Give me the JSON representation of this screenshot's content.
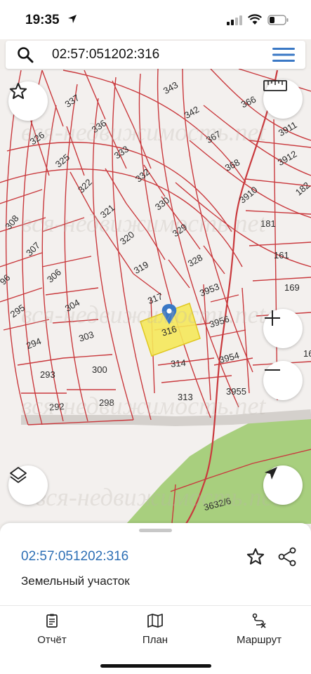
{
  "status": {
    "time": "19:35"
  },
  "search": {
    "query": "02:57:051202:316"
  },
  "map": {
    "selected_parcel": "316",
    "parcels": [
      {
        "id": "337",
        "label": "337"
      },
      {
        "id": "336",
        "label": "336"
      },
      {
        "id": "333",
        "label": "333"
      },
      {
        "id": "326",
        "label": "326"
      },
      {
        "id": "325",
        "label": "325"
      },
      {
        "id": "322",
        "label": "322"
      },
      {
        "id": "332",
        "label": "332"
      },
      {
        "id": "321",
        "label": "321"
      },
      {
        "id": "330",
        "label": "330"
      },
      {
        "id": "320",
        "label": "320"
      },
      {
        "id": "329",
        "label": "329"
      },
      {
        "id": "319",
        "label": "319"
      },
      {
        "id": "328",
        "label": "328"
      },
      {
        "id": "317",
        "label": "317"
      },
      {
        "id": "3953",
        "label": "3953"
      },
      {
        "id": "316",
        "label": "316"
      },
      {
        "id": "3956",
        "label": "3956"
      },
      {
        "id": "314",
        "label": "314"
      },
      {
        "id": "3954",
        "label": "3954"
      },
      {
        "id": "313",
        "label": "313"
      },
      {
        "id": "3955",
        "label": "3955"
      },
      {
        "id": "343",
        "label": "343"
      },
      {
        "id": "342",
        "label": "342"
      },
      {
        "id": "367",
        "label": "367"
      },
      {
        "id": "366",
        "label": "366"
      },
      {
        "id": "3911",
        "label": "3911"
      },
      {
        "id": "368",
        "label": "368"
      },
      {
        "id": "3912",
        "label": "3912"
      },
      {
        "id": "3910",
        "label": "3910"
      },
      {
        "id": "182",
        "label": "182"
      },
      {
        "id": "181",
        "label": "181"
      },
      {
        "id": "161",
        "label": "161"
      },
      {
        "id": "169",
        "label": "169"
      },
      {
        "id": "16",
        "label": "16"
      },
      {
        "id": "308",
        "label": "308"
      },
      {
        "id": "307",
        "label": "307"
      },
      {
        "id": "306",
        "label": "306"
      },
      {
        "id": "96",
        "label": "96"
      },
      {
        "id": "295",
        "label": "295"
      },
      {
        "id": "304",
        "label": "304"
      },
      {
        "id": "294",
        "label": "294"
      },
      {
        "id": "303",
        "label": "303"
      },
      {
        "id": "293",
        "label": "293"
      },
      {
        "id": "300",
        "label": "300"
      },
      {
        "id": "292",
        "label": "292"
      },
      {
        "id": "298",
        "label": "298"
      },
      {
        "id": "3632_6",
        "label": "3632/6"
      }
    ],
    "watermark": "вся-недвижимость.net",
    "colors": {
      "boundary": "#c9393d",
      "selected_fill": "#f5e85a",
      "forest": "#a8cf7e",
      "marker": "#3a78c5"
    }
  },
  "card": {
    "cadastral_id": "02:57:051202:316",
    "object_type": "Земельный участок"
  },
  "tabs": [
    {
      "label": "Отчёт",
      "icon": "report-icon"
    },
    {
      "label": "План",
      "icon": "map-plan-icon"
    },
    {
      "label": "Маршрут",
      "icon": "route-icon"
    }
  ]
}
